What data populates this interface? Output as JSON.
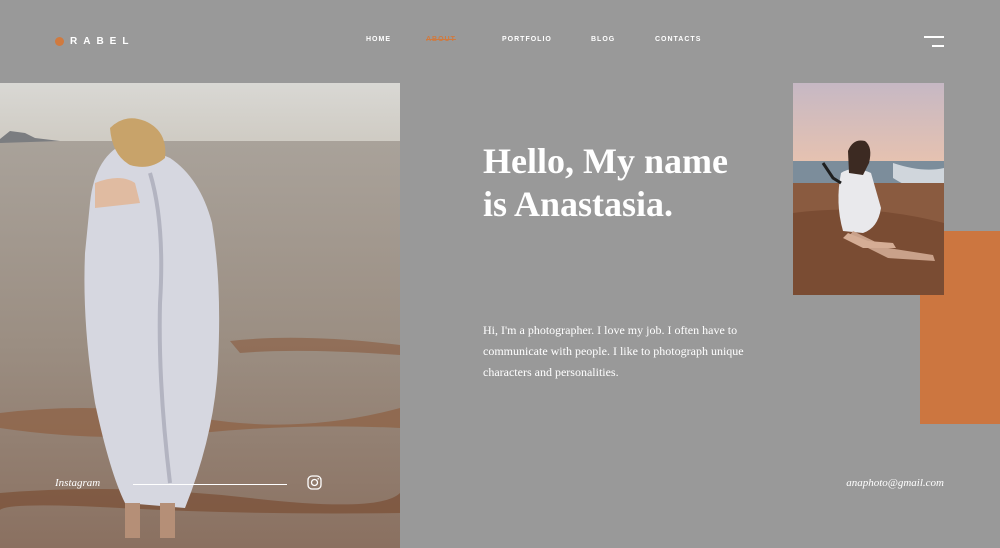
{
  "brand": {
    "logo_text": "RABEL",
    "accent_color": "#d07a3f"
  },
  "nav": {
    "items": [
      {
        "label": "HOME",
        "active": false
      },
      {
        "label": "ABOUT",
        "active": true
      },
      {
        "label": "PORTFOLIO",
        "active": false
      },
      {
        "label": "BLOG",
        "active": false
      },
      {
        "label": "CONTACTS",
        "active": false
      }
    ],
    "menu_icon": "hamburger-icon"
  },
  "hero": {
    "headline": "Hello, My name is Anastasia.",
    "intro": "Hi, I'm a photographer. I love my job. I often have to communicate with people. I like to photograph unique characters and personalities."
  },
  "social": {
    "instagram_label": "Instagram",
    "instagram_icon": "instagram-icon"
  },
  "contact": {
    "email": "anaphoto@gmail.com"
  },
  "colors": {
    "background": "#999999",
    "block": "#cc7640",
    "text": "#ffffff"
  }
}
